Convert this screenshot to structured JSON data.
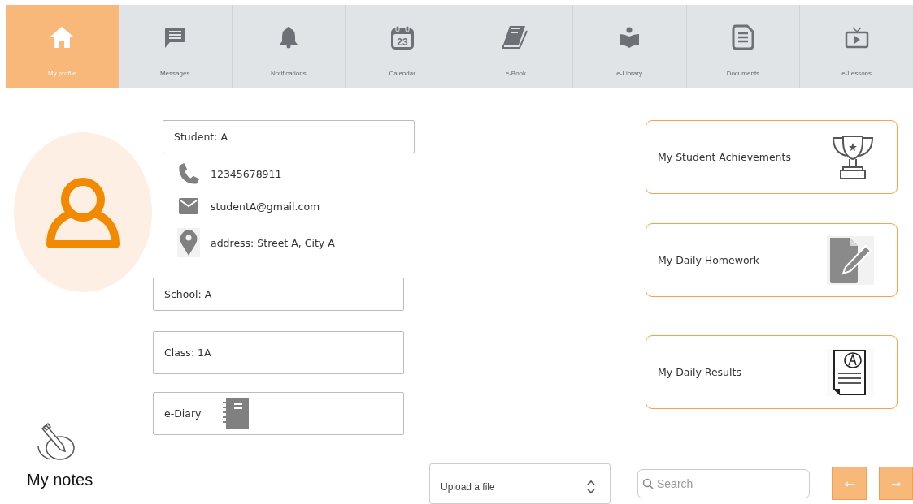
{
  "tabs": [
    {
      "label": "My profile",
      "kind": "home",
      "selected": true
    },
    {
      "label": "Messages",
      "kind": "message",
      "selected": false
    },
    {
      "label": "Notifications",
      "kind": "bell",
      "selected": false
    },
    {
      "label": "Calendar",
      "kind": "calendar",
      "icon_text": "23",
      "selected": false
    },
    {
      "label": "e-Book",
      "kind": "book",
      "selected": false
    },
    {
      "label": "e-Library",
      "kind": "reader",
      "selected": false
    },
    {
      "label": "Documents",
      "kind": "document",
      "selected": false
    },
    {
      "label": "e-Lessons",
      "kind": "tv",
      "selected": false
    }
  ],
  "profile": {
    "name_field": "Student: A",
    "contacts": [
      {
        "kind": "phone",
        "text": "12345678911"
      },
      {
        "kind": "email",
        "text": "studentA@gmail.com"
      },
      {
        "kind": "address",
        "text": "address: Street A, City A"
      }
    ],
    "fields": [
      {
        "label": "School: A"
      },
      {
        "label": "Class: 1A"
      },
      {
        "label": "e-Diary",
        "kind": "diary"
      }
    ]
  },
  "notes": {
    "label": "My notes"
  },
  "cards": [
    {
      "label": "My Student Achievements",
      "kind": "trophy"
    },
    {
      "label": "My Daily Homework",
      "kind": "homework"
    },
    {
      "label": "My Daily Results",
      "kind": "results"
    }
  ],
  "upload": {
    "label": "Upload a file"
  },
  "search": {
    "placeholder": "Search"
  },
  "nav_buttons": [
    {
      "label": "←",
      "kind": "prev"
    },
    {
      "label": "→",
      "kind": "next"
    }
  ]
}
